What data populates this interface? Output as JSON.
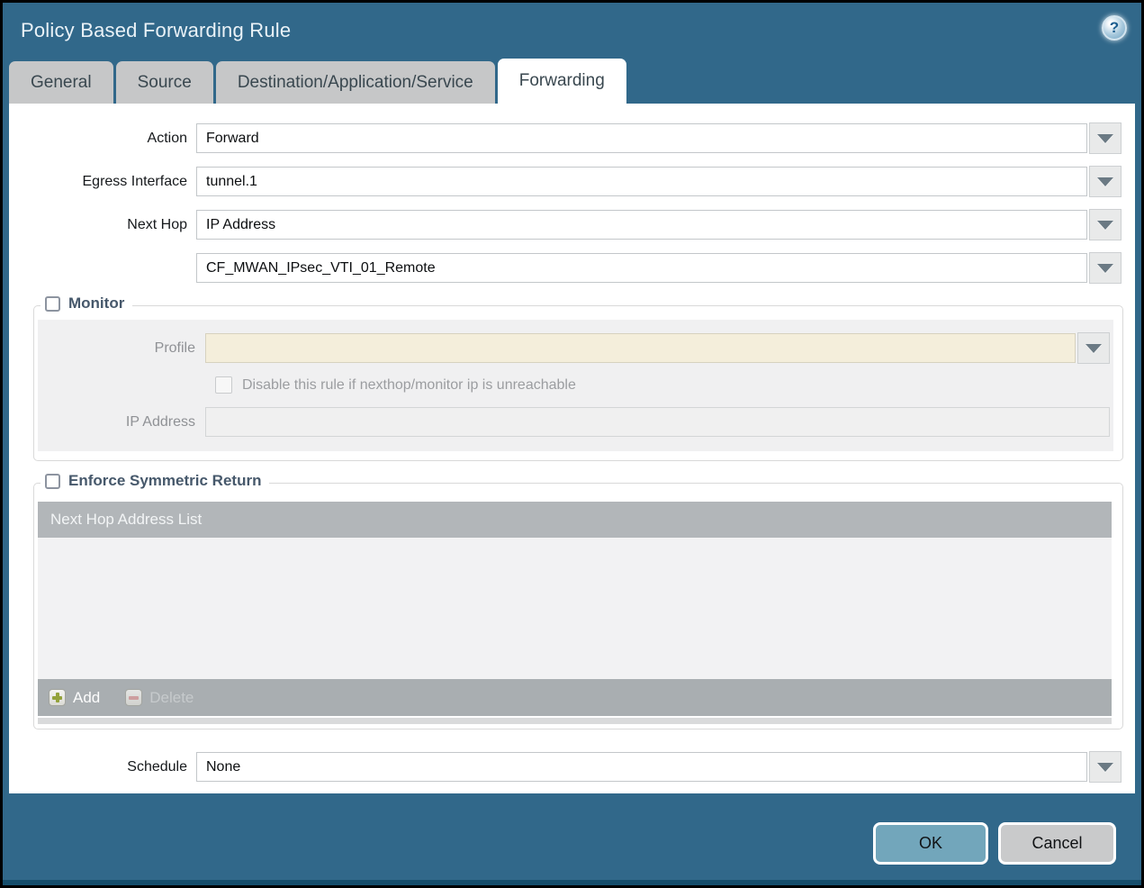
{
  "colors": {
    "titlebar_teal": "#31688a",
    "tab_inactive": "#c6c7c8",
    "ok_button": "#72a6bb",
    "cancel_button": "#c9cacb",
    "profile_field_cream": "#f4eedb",
    "table_header_gray": "#b2b6b9",
    "table_footer_gray": "#a9aeb1",
    "legend_text": "#46586b"
  },
  "window": {
    "title": "Policy Based Forwarding Rule"
  },
  "icons": {
    "help": "question-mark-circle",
    "dropdown": "chevron-down",
    "add": "plus",
    "delete": "minus"
  },
  "tabs": [
    {
      "label": "General",
      "active": false
    },
    {
      "label": "Source",
      "active": false
    },
    {
      "label": "Destination/Application/Service",
      "active": false
    },
    {
      "label": "Forwarding",
      "active": true
    }
  ],
  "form": {
    "action": {
      "label": "Action",
      "value": "Forward"
    },
    "egress_interface": {
      "label": "Egress Interface",
      "value": "tunnel.1"
    },
    "next_hop": {
      "label": "Next Hop",
      "value": "IP Address"
    },
    "next_hop_address": {
      "value": "CF_MWAN_IPsec_VTI_01_Remote"
    },
    "schedule": {
      "label": "Schedule",
      "value": "None"
    }
  },
  "monitor": {
    "legend": "Monitor",
    "checked": false,
    "profile": {
      "label": "Profile",
      "value": "",
      "disabled": true
    },
    "disable_rule": {
      "label": "Disable this rule if nexthop/monitor ip is unreachable",
      "checked": false,
      "disabled": true
    },
    "ip_address": {
      "label": "IP Address",
      "value": "",
      "disabled": true
    }
  },
  "symmetric_return": {
    "legend": "Enforce Symmetric Return",
    "checked": false,
    "table": {
      "header": "Next Hop Address List",
      "rows": []
    },
    "add_label": "Add",
    "delete_label": "Delete",
    "delete_disabled": true
  },
  "footer": {
    "ok_label": "OK",
    "cancel_label": "Cancel"
  }
}
